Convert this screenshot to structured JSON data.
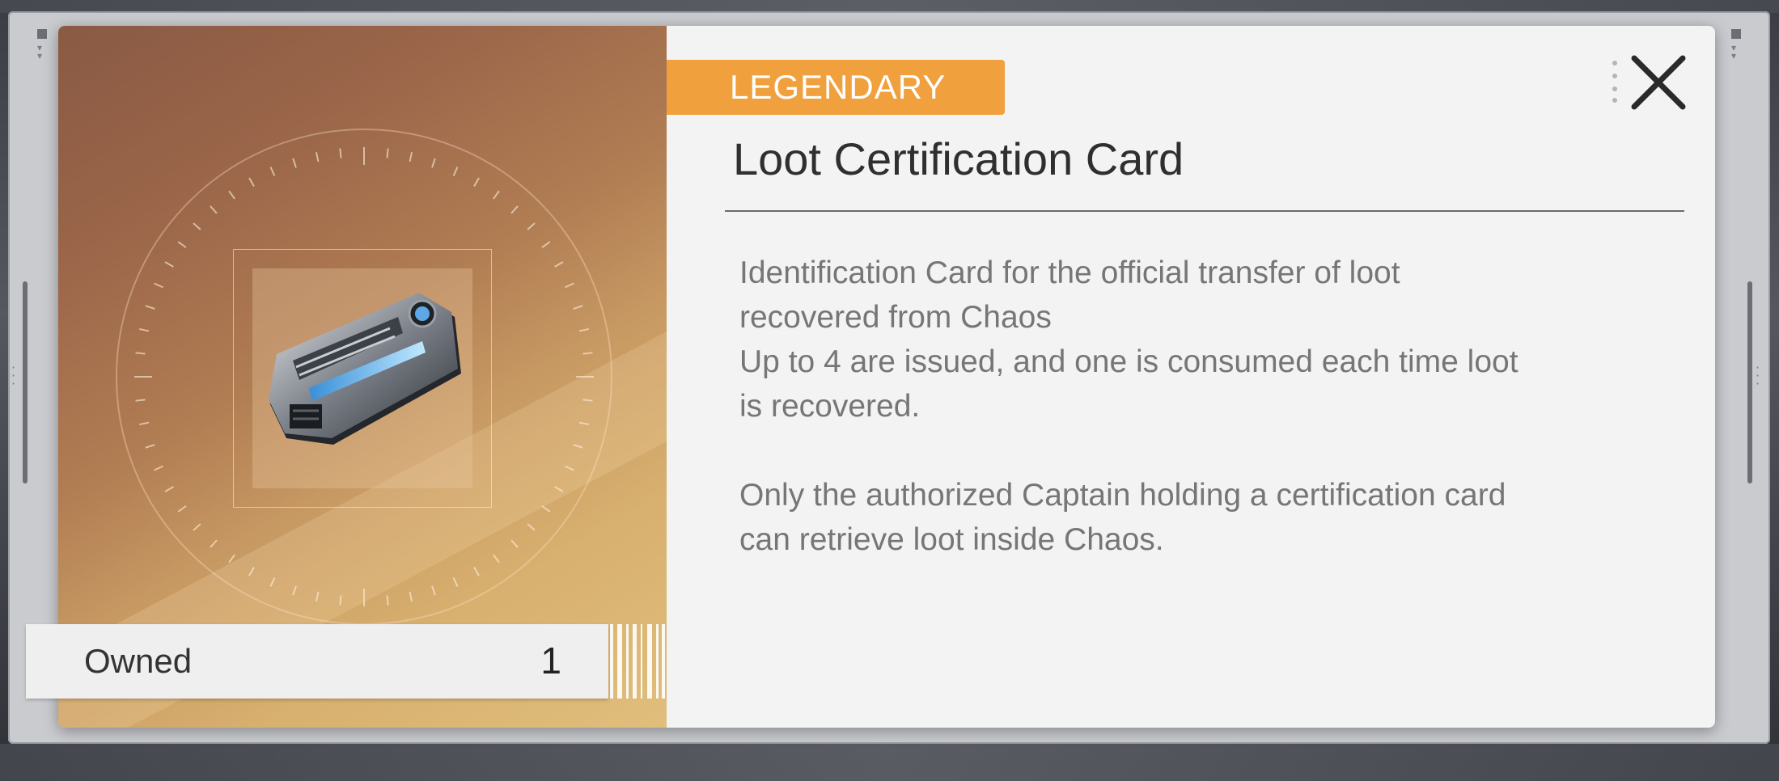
{
  "item": {
    "rarity": "LEGENDARY",
    "name": "Loot Certification Card",
    "description": "Identification Card for the official transfer of loot\nrecovered from Chaos\nUp to 4 are issued, and one is consumed each time loot\nis recovered.\n\nOnly the authorized Captain holding a certification card\ncan retrieve loot inside Chaos.",
    "image_icon": "id-card-icon",
    "owned_label": "Owned",
    "owned_count": "1"
  },
  "controls": {
    "close_icon": "close-icon"
  },
  "colors": {
    "rarity_badge": "#f0a03c",
    "panel_bg": "#f3f3f3",
    "title_text": "#2f2f2f",
    "description_text": "#767676"
  }
}
